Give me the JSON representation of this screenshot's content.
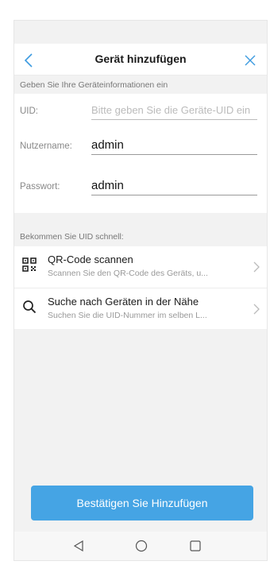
{
  "header": {
    "title": "Gerät hinzufügen",
    "back_icon": "chevron-left-icon",
    "close_icon": "close-icon"
  },
  "form": {
    "hint": "Geben Sie Ihre Geräteinformationen ein",
    "uid": {
      "label": "UID:",
      "placeholder": "Bitte geben Sie die Geräte-UID ein",
      "value": ""
    },
    "username": {
      "label": "Nutzername:",
      "value": "admin"
    },
    "password": {
      "label": "Passwort:",
      "value": "admin"
    }
  },
  "quick": {
    "label": "Bekommen Sie UID schnell:",
    "items": [
      {
        "icon": "qr-code-icon",
        "title": "QR-Code scannen",
        "subtitle": "Scannen Sie den QR-Code des Geräts, u..."
      },
      {
        "icon": "search-icon",
        "title": "Suche nach Geräten in der Nähe",
        "subtitle": "Suchen Sie die UID-Nummer im selben L..."
      }
    ]
  },
  "confirm_label": "Bestätigen Sie Hinzufügen",
  "colors": {
    "accent": "#45a4e4",
    "background": "#f2f2f2"
  },
  "navbar": {
    "icons": [
      "back-triangle-icon",
      "home-circle-icon",
      "recents-square-icon"
    ]
  }
}
